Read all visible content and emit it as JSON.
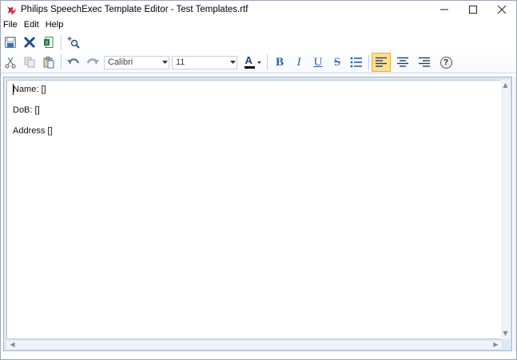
{
  "window": {
    "title": "Philips SpeechExec Template Editor - Test Templates.rtf",
    "accent_color": "#d3203b"
  },
  "menu": {
    "items": [
      "File",
      "Edit",
      "Help"
    ]
  },
  "toolbar": {
    "row1": [
      "save-icon",
      "delete-icon",
      "export-excel-icon",
      "zoom-icon"
    ],
    "font_name": "Calibri",
    "font_size": "11",
    "font_color_label": "A",
    "bold_label": "B",
    "italic_label": "I",
    "underline_label": "U",
    "strike_label": "S",
    "help_label": "?",
    "active_alignment": "left",
    "active_color": "#fddf8f"
  },
  "document": {
    "lines": [
      "Name: []",
      "DoB: []",
      "Address []"
    ]
  }
}
